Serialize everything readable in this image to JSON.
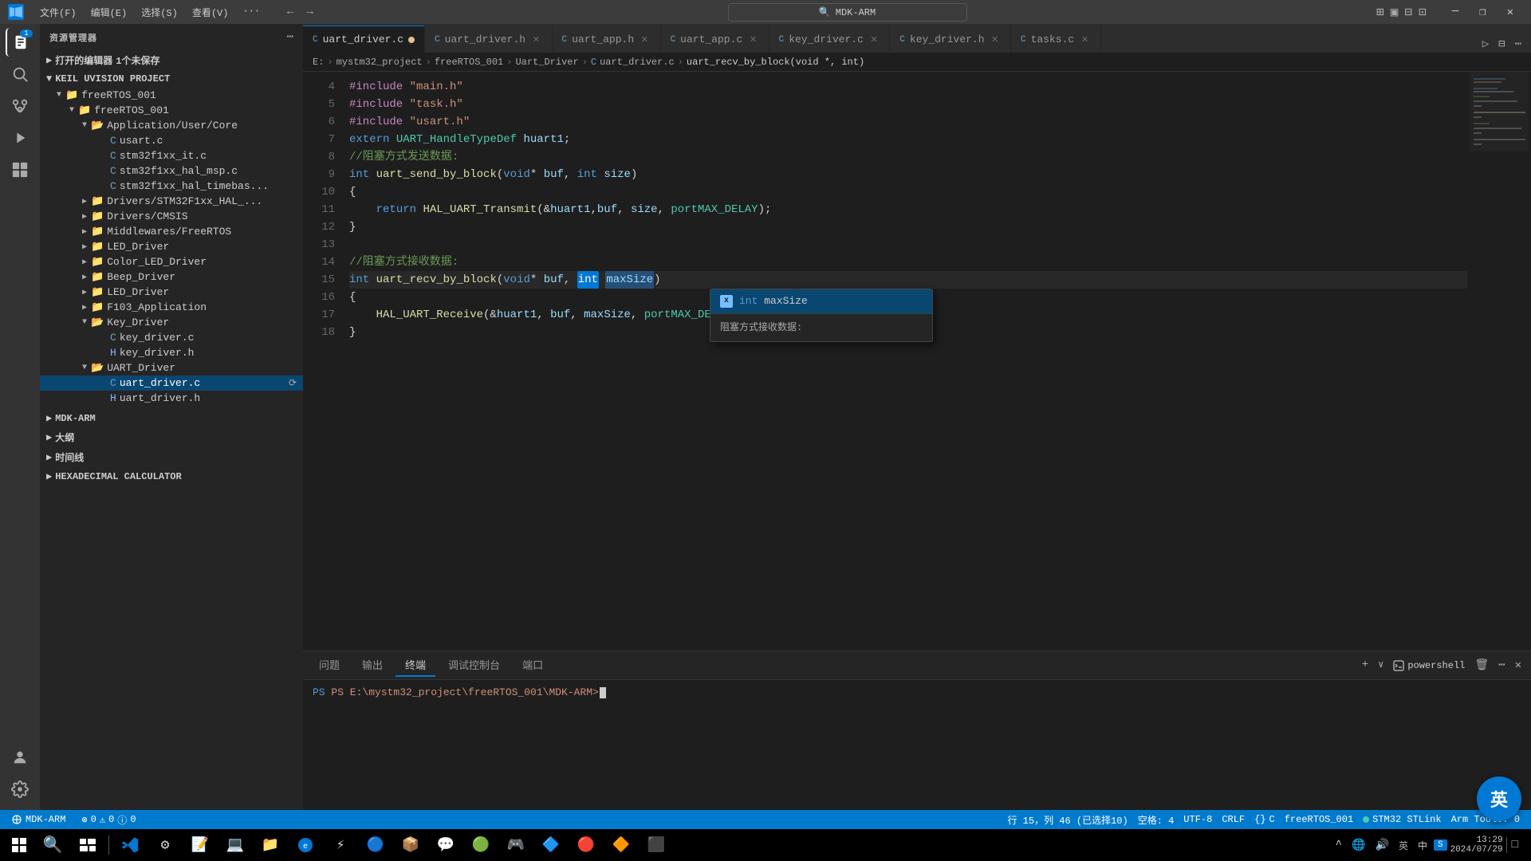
{
  "titlebar": {
    "app_icon": "VS",
    "menus": [
      "文件(F)",
      "编辑(E)",
      "选择(S)",
      "查看(V)",
      "···"
    ],
    "search_placeholder": "MDK-ARM",
    "win_controls": [
      "—",
      "❐",
      "✕"
    ]
  },
  "sidebar": {
    "title": "资源管理器",
    "open_editors_label": "打开的编辑器",
    "open_editors_badge": "1个未保存",
    "project_label": "KEIL UVISION PROJECT",
    "project_root": "freeRTOS_001",
    "bottom_sections": [
      "MDK-ARM",
      "大纲",
      "时间线",
      "HEXADECIMAL CALCULATOR"
    ],
    "tree": [
      {
        "id": "freertos001_1",
        "label": "freeRTOS_001",
        "type": "folder",
        "depth": 1,
        "expanded": true
      },
      {
        "id": "freertos001_2",
        "label": "freeRTOS_001",
        "type": "folder",
        "depth": 2,
        "expanded": true
      },
      {
        "id": "app_user_core",
        "label": "Application/User/Core",
        "type": "folder",
        "depth": 3,
        "expanded": true
      },
      {
        "id": "usart_c",
        "label": "usart.c",
        "type": "c-file",
        "depth": 4
      },
      {
        "id": "stm32f1xx_it_c",
        "label": "stm32f1xx_it.c",
        "type": "c-file",
        "depth": 4
      },
      {
        "id": "stm32f1xx_hal_msp_c",
        "label": "stm32f1xx_hal_msp.c",
        "type": "c-file",
        "depth": 4
      },
      {
        "id": "stm32f1xx_hal_timebas",
        "label": "stm32f1xx_hal_timebas...",
        "type": "c-file",
        "depth": 4
      },
      {
        "id": "drivers_stm32",
        "label": "Drivers/STM32F1xx_HAL_...",
        "type": "folder",
        "depth": 3,
        "expanded": false
      },
      {
        "id": "drivers_cmsis",
        "label": "Drivers/CMSIS",
        "type": "folder",
        "depth": 3,
        "expanded": false
      },
      {
        "id": "middlewares",
        "label": "Middlewares/FreeRTOS",
        "type": "folder",
        "depth": 3,
        "expanded": false
      },
      {
        "id": "led_driver",
        "label": "LED_Driver",
        "type": "folder",
        "depth": 3,
        "expanded": false
      },
      {
        "id": "color_led",
        "label": "Color_LED_Driver",
        "type": "folder",
        "depth": 3,
        "expanded": false
      },
      {
        "id": "beep_driver",
        "label": "Beep_Driver",
        "type": "folder",
        "depth": 3,
        "expanded": false
      },
      {
        "id": "led_driver2",
        "label": "LED_Driver",
        "type": "folder",
        "depth": 3,
        "expanded": false
      },
      {
        "id": "f103_app",
        "label": "F103_Application",
        "type": "folder",
        "depth": 3,
        "expanded": false
      },
      {
        "id": "key_driver",
        "label": "Key_Driver",
        "type": "folder",
        "depth": 3,
        "expanded": true
      },
      {
        "id": "key_driver_c",
        "label": "key_driver.c",
        "type": "c-file",
        "depth": 4
      },
      {
        "id": "key_driver_h",
        "label": "key_driver.h",
        "type": "h-file",
        "depth": 4
      },
      {
        "id": "uart_driver",
        "label": "UART_Driver",
        "type": "folder",
        "depth": 3,
        "expanded": true
      },
      {
        "id": "uart_driver_c",
        "label": "uart_driver.c",
        "type": "c-file",
        "depth": 4,
        "active": true
      },
      {
        "id": "uart_driver_h",
        "label": "uart_driver.h",
        "type": "h-file",
        "depth": 4
      }
    ]
  },
  "tabs": [
    {
      "id": "uart_driver_c",
      "label": "uart_driver.c",
      "type": "c",
      "modified": true,
      "active": true
    },
    {
      "id": "uart_driver_h",
      "label": "uart_driver.h",
      "type": "c"
    },
    {
      "id": "uart_app_h",
      "label": "uart_app.h",
      "type": "c"
    },
    {
      "id": "uart_app_c",
      "label": "uart_app.c",
      "type": "c"
    },
    {
      "id": "key_driver_c",
      "label": "key_driver.c",
      "type": "c"
    },
    {
      "id": "key_driver_h",
      "label": "key_driver.h",
      "type": "c"
    },
    {
      "id": "tasks_c",
      "label": "tasks.c",
      "type": "c"
    }
  ],
  "breadcrumb": {
    "parts": [
      "E:",
      "mystm32_project",
      "freeRTOS_001",
      "Uart_Driver",
      "uart_driver.c",
      "uart_recv_by_block(void *, int)"
    ]
  },
  "code": {
    "lines": [
      {
        "num": 4,
        "content": "#include \"main.h\""
      },
      {
        "num": 5,
        "content": "#include \"task.h\""
      },
      {
        "num": 6,
        "content": "#include \"usart.h\""
      },
      {
        "num": 7,
        "content": "extern UART_HandleTypeDef huart1;"
      },
      {
        "num": 8,
        "content": "//阻塞方式发送数据:"
      },
      {
        "num": 9,
        "content": "int uart_send_by_block(void* buf, int size)"
      },
      {
        "num": 10,
        "content": "{"
      },
      {
        "num": 11,
        "content": "    return HAL_UART_Transmit(&huart1,buf, size, portMAX_DELAY);"
      },
      {
        "num": 12,
        "content": "}"
      },
      {
        "num": 13,
        "content": ""
      },
      {
        "num": 14,
        "content": "//阻塞方式接收数据:"
      },
      {
        "num": 15,
        "content": "int uart_recv_by_block(void* buf, int maxSize)"
      },
      {
        "num": 16,
        "content": "{"
      },
      {
        "num": 17,
        "content": "    HAL_UART_Receive(&huart1, buf, maxSize, portMAX_DELAY);"
      },
      {
        "num": 18,
        "content": "}"
      }
    ]
  },
  "autocomplete": {
    "items": [
      {
        "label": "int maxSize",
        "type": "var",
        "icon": "x"
      },
      {
        "label": "阻塞方式接收数据:",
        "type": "comment"
      }
    ]
  },
  "panel": {
    "tabs": [
      "问题",
      "输出",
      "终端",
      "调试控制台",
      "端口"
    ],
    "active_tab": "终端",
    "terminal_type": "powershell",
    "terminal_content": "PS E:\\mystm32_project\\freeRTOS_001\\MDK-ARM>"
  },
  "statusbar": {
    "remote": "MDK-ARM",
    "errors": "0",
    "warnings": "0",
    "info": "0",
    "position": "行 15，列 46 (已选择10)",
    "spaces": "空格: 4",
    "encoding": "UTF-8",
    "line_ending": "CRLF",
    "language": "C",
    "project": "freeRTOS_001"
  },
  "taskbar": {
    "time": "13:29",
    "date": "2024/07/29",
    "ime_label": "英"
  }
}
